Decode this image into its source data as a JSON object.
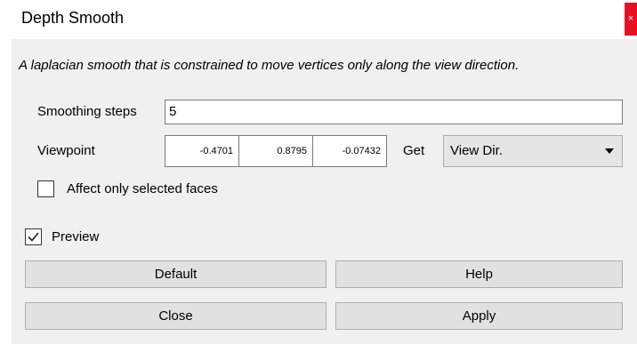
{
  "window": {
    "title": "Depth Smooth",
    "close_glyph": "×"
  },
  "description": "A laplacian smooth that is constrained to move vertices only along the view direction.",
  "smoothing_steps": {
    "label": "Smoothing steps",
    "value": "5"
  },
  "viewpoint": {
    "label": "Viewpoint",
    "x": "-0.4701",
    "y": "0.8795",
    "z": "-0.07432",
    "get_label": "Get",
    "get_selected": "View Dir."
  },
  "affect_selected": {
    "label": "Affect only selected faces",
    "checked": false
  },
  "preview": {
    "label": "Preview",
    "checked": true
  },
  "buttons": {
    "default": "Default",
    "help": "Help",
    "close": "Close",
    "apply": "Apply"
  }
}
